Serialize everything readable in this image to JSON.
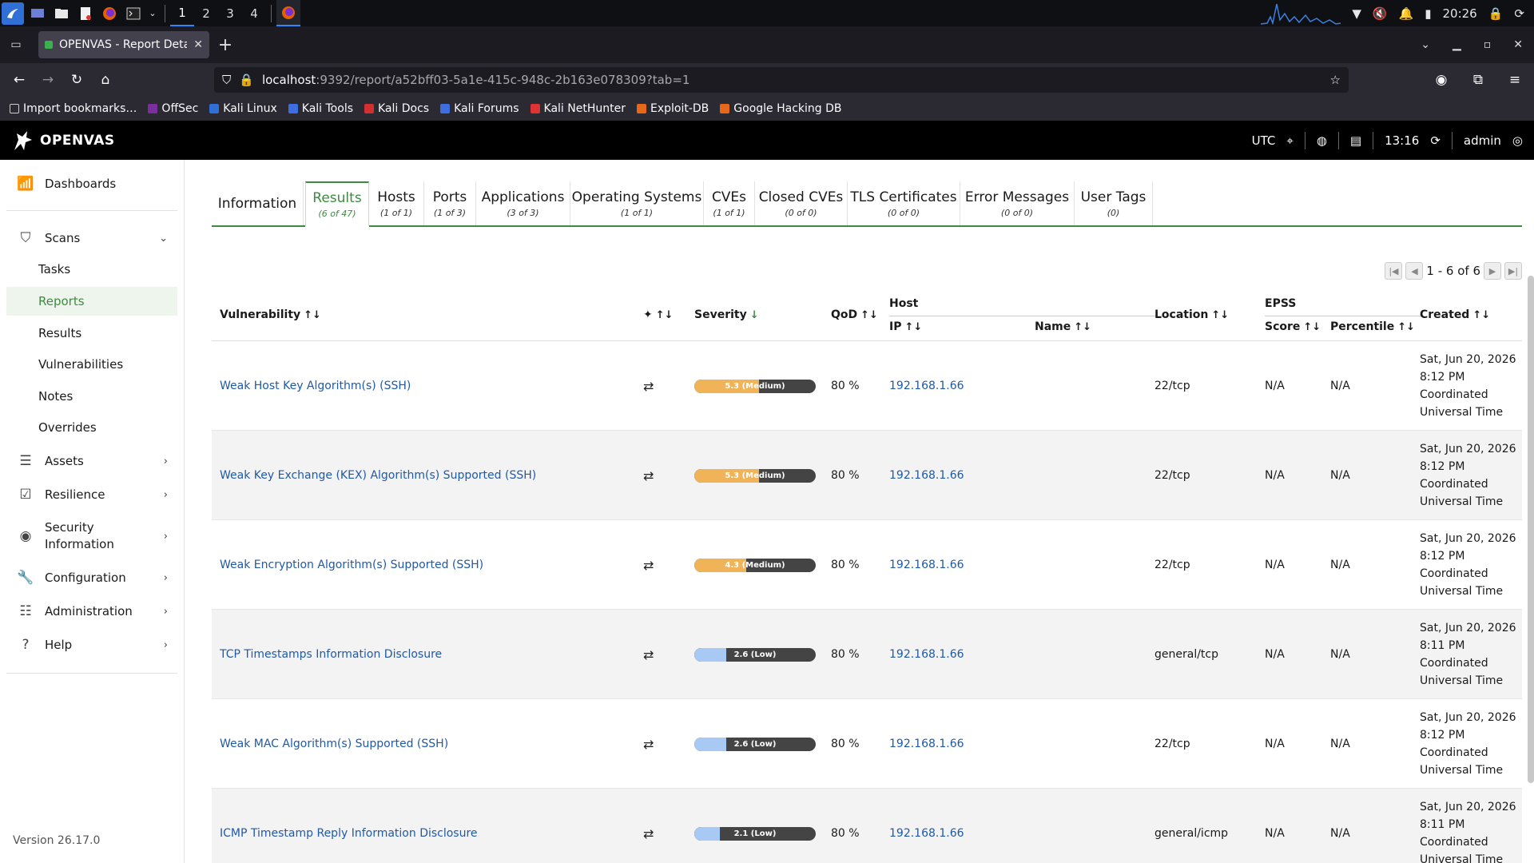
{
  "taskbar": {
    "workspaces": [
      "1",
      "2",
      "3",
      "4"
    ],
    "active_workspace": "1",
    "time": "20:26"
  },
  "browser": {
    "tab_title": "OPENVAS - Report Details",
    "url_host": "localhost",
    "url_path": ":9392/report/a52bff03-5a1e-415c-948c-2b163e078309?tab=1",
    "bookmarks": [
      "Import bookmarks…",
      "OffSec",
      "Kali Linux",
      "Kali Tools",
      "Kali Docs",
      "Kali Forums",
      "Kali NetHunter",
      "Exploit-DB",
      "Google Hacking DB"
    ]
  },
  "header": {
    "brand": "OPENVAS",
    "timezone": "UTC",
    "time": "13:16",
    "user": "admin"
  },
  "sidebar": {
    "dashboards": "Dashboards",
    "scans": "Scans",
    "scan_items": [
      "Tasks",
      "Reports",
      "Results",
      "Vulnerabilities",
      "Notes",
      "Overrides"
    ],
    "assets": "Assets",
    "resilience": "Resilience",
    "security_information_1": "Security",
    "security_information_2": "Information",
    "configuration": "Configuration",
    "administration": "Administration",
    "help": "Help",
    "version": "Version 26.17.0"
  },
  "report_tabs": [
    {
      "label": "Information",
      "count": ""
    },
    {
      "label": "Results",
      "count": "(6 of 47)"
    },
    {
      "label": "Hosts",
      "count": "(1 of 1)"
    },
    {
      "label": "Ports",
      "count": "(1 of 3)"
    },
    {
      "label": "Applications",
      "count": "(3 of 3)"
    },
    {
      "label": "Operating Systems",
      "count": "(1 of 1)"
    },
    {
      "label": "CVEs",
      "count": "(1 of 1)"
    },
    {
      "label": "Closed CVEs",
      "count": "(0 of 0)"
    },
    {
      "label": "TLS Certificates",
      "count": "(0 of 0)"
    },
    {
      "label": "Error Messages",
      "count": "(0 of 0)"
    },
    {
      "label": "User Tags",
      "count": "(0)"
    }
  ],
  "pager": {
    "text": "1 - 6 of 6"
  },
  "table": {
    "headers": {
      "vulnerability": "Vulnerability",
      "severity": "Severity",
      "qod": "QoD",
      "host": "Host",
      "ip": "IP",
      "name": "Name",
      "location": "Location",
      "epss": "EPSS",
      "score": "Score",
      "percentile": "Percentile",
      "created": "Created"
    },
    "rows": [
      {
        "vulnerability": "Weak Host Key Algorithm(s) (SSH)",
        "severity_label": "5.3 (Medium)",
        "severity": 5.3,
        "level": "medium",
        "qod": "80 %",
        "ip": "192.168.1.66",
        "name": "",
        "location": "22/tcp",
        "score": "N/A",
        "percentile": "N/A",
        "created": [
          "Sat, Jun 20, 2026",
          "8:12 PM",
          "Coordinated",
          "Universal Time"
        ]
      },
      {
        "vulnerability": "Weak Key Exchange (KEX) Algorithm(s) Supported (SSH)",
        "severity_label": "5.3 (Medium)",
        "severity": 5.3,
        "level": "medium",
        "qod": "80 %",
        "ip": "192.168.1.66",
        "name": "",
        "location": "22/tcp",
        "score": "N/A",
        "percentile": "N/A",
        "created": [
          "Sat, Jun 20, 2026",
          "8:12 PM",
          "Coordinated",
          "Universal Time"
        ]
      },
      {
        "vulnerability": "Weak Encryption Algorithm(s) Supported (SSH)",
        "severity_label": "4.3 (Medium)",
        "severity": 4.3,
        "level": "medium",
        "qod": "80 %",
        "ip": "192.168.1.66",
        "name": "",
        "location": "22/tcp",
        "score": "N/A",
        "percentile": "N/A",
        "created": [
          "Sat, Jun 20, 2026",
          "8:12 PM",
          "Coordinated",
          "Universal Time"
        ]
      },
      {
        "vulnerability": "TCP Timestamps Information Disclosure",
        "severity_label": "2.6 (Low)",
        "severity": 2.6,
        "level": "low",
        "qod": "80 %",
        "ip": "192.168.1.66",
        "name": "",
        "location": "general/tcp",
        "score": "N/A",
        "percentile": "N/A",
        "created": [
          "Sat, Jun 20, 2026",
          "8:11 PM",
          "Coordinated",
          "Universal Time"
        ]
      },
      {
        "vulnerability": "Weak MAC Algorithm(s) Supported (SSH)",
        "severity_label": "2.6 (Low)",
        "severity": 2.6,
        "level": "low",
        "qod": "80 %",
        "ip": "192.168.1.66",
        "name": "",
        "location": "22/tcp",
        "score": "N/A",
        "percentile": "N/A",
        "created": [
          "Sat, Jun 20, 2026",
          "8:12 PM",
          "Coordinated",
          "Universal Time"
        ]
      },
      {
        "vulnerability": "ICMP Timestamp Reply Information Disclosure",
        "severity_label": "2.1 (Low)",
        "severity": 2.1,
        "level": "low",
        "qod": "80 %",
        "ip": "192.168.1.66",
        "name": "",
        "location": "general/icmp",
        "score": "N/A",
        "percentile": "N/A",
        "created": [
          "Sat, Jun 20, 2026",
          "8:11 PM",
          "Coordinated",
          "Universal Time"
        ]
      }
    ]
  },
  "colors": {
    "accent": "#3d8b40",
    "link": "#1f59a8",
    "medium": "#f0b357",
    "low": "#a9c9f5"
  }
}
